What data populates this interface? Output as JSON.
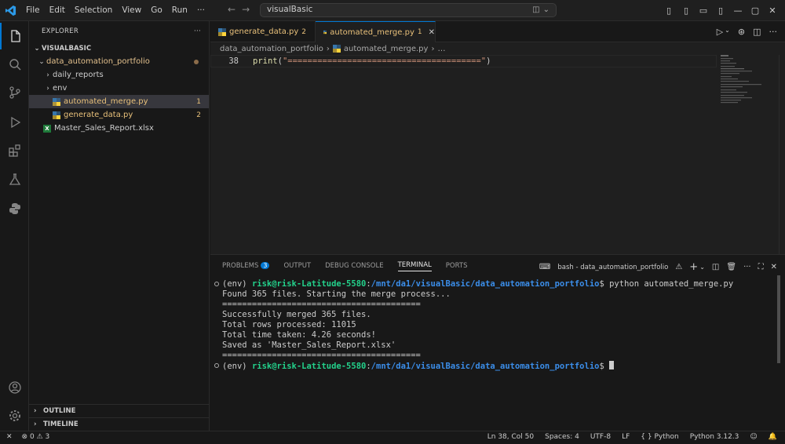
{
  "menu": [
    "File",
    "Edit",
    "Selection",
    "View",
    "Go",
    "Run",
    "···"
  ],
  "command_center": {
    "text": "visualBasic"
  },
  "explorer": {
    "title": "EXPLORER",
    "more": "···",
    "root": "VISUALBASIC",
    "folder": "data_automation_portfolio",
    "items": [
      {
        "label": "daily_reports",
        "type": "folder"
      },
      {
        "label": "env",
        "type": "folder"
      },
      {
        "label": "automated_merge.py",
        "type": "python",
        "badge": "1"
      },
      {
        "label": "generate_data.py",
        "type": "python",
        "badge": "2"
      },
      {
        "label": "Master_Sales_Report.xlsx",
        "type": "excel"
      }
    ],
    "outline": "OUTLINE",
    "timeline": "TIMELINE"
  },
  "tabs": [
    {
      "label": "generate_data.py",
      "badge": "2"
    },
    {
      "label": "automated_merge.py",
      "badge": "1",
      "close": "✕"
    }
  ],
  "breadcrumb": [
    "data_automation_portfolio",
    "automated_merge.py",
    "…"
  ],
  "editor": {
    "line_number": "38",
    "code_fn": "print",
    "code_open": "(",
    "code_str": "\"=======================================\"",
    "code_close": ")"
  },
  "panel": {
    "tabs": [
      "PROBLEMS",
      "OUTPUT",
      "DEBUG CONSOLE",
      "TERMINAL",
      "PORTS"
    ],
    "problems_count": "3",
    "terminal_name": "bash - data_automation_portfolio",
    "terminal_lines": [
      {
        "kind": "prompt",
        "env": "(env) ",
        "user": "risk@risk-Latitude-5580",
        "sep": ":",
        "path": "/mnt/da1/visualBasic/data_automation_portfolio",
        "tail": "$ python automated_merge.py"
      },
      {
        "kind": "out",
        "text": "Found 365 files. Starting the merge process..."
      },
      {
        "kind": "out",
        "text": "========================================"
      },
      {
        "kind": "out",
        "text": "Successfully merged 365 files."
      },
      {
        "kind": "out",
        "text": "Total rows processed: 11015"
      },
      {
        "kind": "out",
        "text": "Total time taken: 4.26 seconds!"
      },
      {
        "kind": "out",
        "text": "Saved as 'Master_Sales_Report.xlsx'"
      },
      {
        "kind": "out",
        "text": "========================================"
      },
      {
        "kind": "prompt",
        "env": "(env) ",
        "user": "risk@risk-Latitude-5580",
        "sep": ":",
        "path": "/mnt/da1/visualBasic/data_automation_portfolio",
        "tail": "$ "
      }
    ]
  },
  "status": {
    "errors": "0",
    "warnings": "3",
    "position": "Ln 38, Col 50",
    "spaces": "Spaces: 4",
    "encoding": "UTF-8",
    "eol": "LF",
    "braces": "{ }",
    "language": "Python",
    "interpreter": "Python 3.12.3"
  },
  "colors": {
    "accent": "#0078d4",
    "warning_tab": "#e8c07a",
    "terminal_user": "#23d18b",
    "terminal_path": "#3b8eea"
  }
}
